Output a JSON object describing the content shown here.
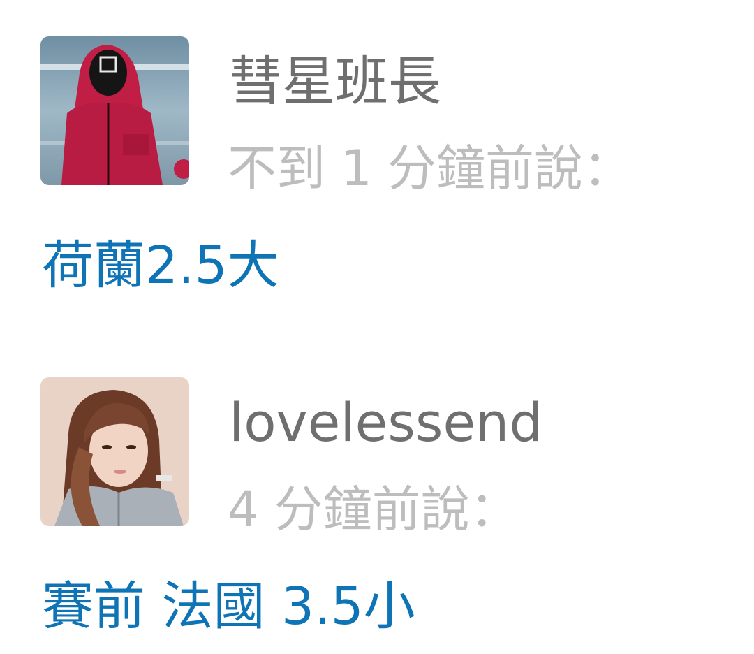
{
  "comments": [
    {
      "username": "彗星班長",
      "timestamp": "不到 1 分鐘前說：",
      "text": "荷蘭2.5大",
      "avatar_icon": "masked-guard-avatar"
    },
    {
      "username": "lovelessend",
      "timestamp": "4 分鐘前說：",
      "text": "賽前 法國 3.5小",
      "avatar_icon": "user-photo-avatar"
    }
  ],
  "colors": {
    "username": "#6f6f6f",
    "timestamp": "#bdbdbd",
    "comment_text": "#0f74b6",
    "background": "#ffffff"
  }
}
